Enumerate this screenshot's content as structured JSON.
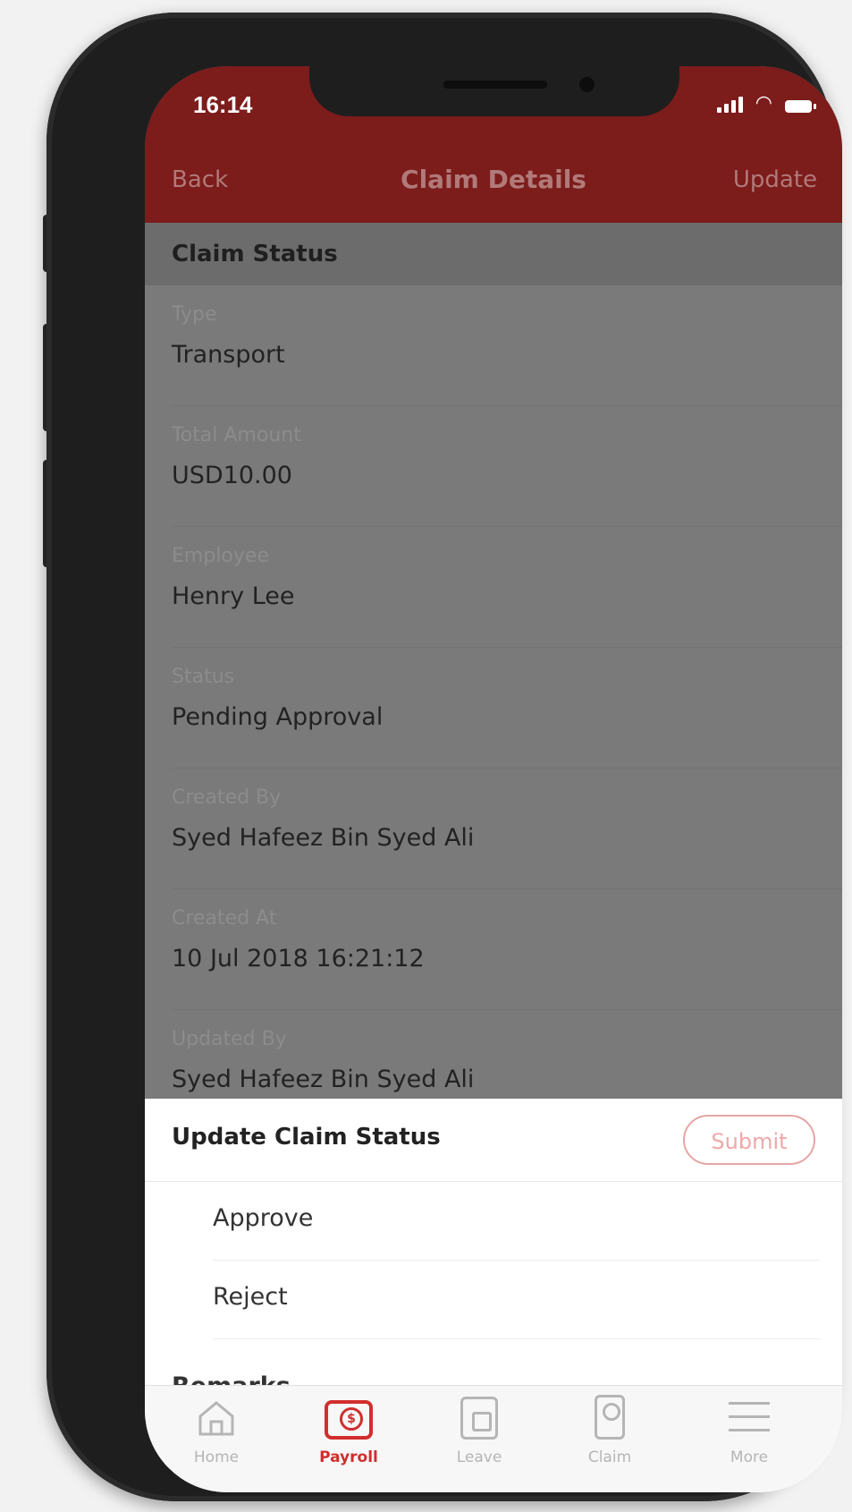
{
  "status_bar": {
    "time": "16:14"
  },
  "nav": {
    "back_label": "Back",
    "title": "Claim Details",
    "update_label": "Update"
  },
  "section": {
    "title": "Claim Status"
  },
  "fields": [
    {
      "label": "Type",
      "value": "Transport"
    },
    {
      "label": "Total Amount",
      "value": "USD10.00"
    },
    {
      "label": "Employee",
      "value": "Henry Lee"
    },
    {
      "label": "Status",
      "value": "Pending Approval"
    },
    {
      "label": "Created By",
      "value": "Syed Hafeez Bin Syed Ali"
    },
    {
      "label": "Created At",
      "value": "10 Jul 2018 16:21:12"
    },
    {
      "label": "Updated By",
      "value": "Syed Hafeez Bin Syed Ali"
    }
  ],
  "sheet": {
    "title": "Update Claim Status",
    "submit_label": "Submit",
    "options": [
      "Approve",
      "Reject"
    ],
    "remarks_label": "Remarks"
  },
  "tabbar": {
    "active": "Payroll",
    "tabs": [
      {
        "label": "Home",
        "icon": "home-icon"
      },
      {
        "label": "Payroll",
        "icon": "payroll-icon"
      },
      {
        "label": "Leave",
        "icon": "calendar-icon"
      },
      {
        "label": "Claim",
        "icon": "claim-icon"
      },
      {
        "label": "More",
        "icon": "menu-icon"
      }
    ]
  },
  "colors": {
    "header": "#7c1c1b",
    "accent": "#d12e2e",
    "overlay": "#7a7a7a"
  }
}
